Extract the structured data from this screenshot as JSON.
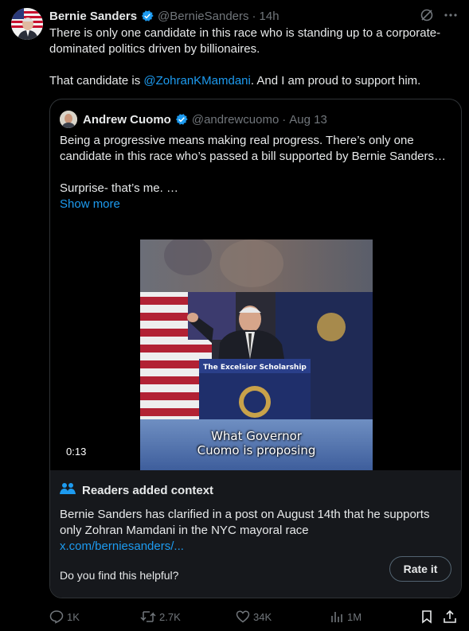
{
  "post": {
    "author_name": "Bernie Sanders",
    "handle": "@BernieSanders",
    "separator": "·",
    "time": "14h",
    "line1": "There is only one candidate in this race who is standing up to a corporate-dominated politics driven by billionaires.",
    "line2_prefix": "That candidate is ",
    "line2_mention": "@ZohranKMamdani",
    "line2_suffix": ". And I am proud to support him."
  },
  "quote": {
    "author_name": "Andrew Cuomo",
    "handle": "@andrewcuomo",
    "separator": "·",
    "date": "Aug 13",
    "text1": "Being a progressive means making real progress. There’s only one candidate in this race who’s passed a bill supported by Bernie Sanders…",
    "text2": "Surprise- that’s me. …",
    "show_more": "Show more",
    "video": {
      "duration": "0:13",
      "podium_sign": "The Excelsior Scholarship",
      "caption_line1": "What Governor",
      "caption_line2": "Cuomo is proposing"
    },
    "context": {
      "title": "Readers added context",
      "text": "Bernie Sanders has clarified in a post on August 14th that he supports only Zohran Mamdani in the NYC mayoral race",
      "link": "x.com/berniesanders/...",
      "question": "Do you find this helpful?",
      "rate_label": "Rate it"
    }
  },
  "actions": {
    "replies": "1K",
    "reposts": "2.7K",
    "likes": "34K",
    "views": "1M"
  },
  "colors": {
    "accent": "#1d9bf0",
    "muted": "#71767b",
    "background": "#000000",
    "context_bg": "#16181c"
  },
  "icons": [
    "verified-icon",
    "grok-icon",
    "more-icon",
    "people-icon",
    "reply-icon",
    "repost-icon",
    "like-icon",
    "views-icon",
    "bookmark-icon",
    "share-icon"
  ]
}
